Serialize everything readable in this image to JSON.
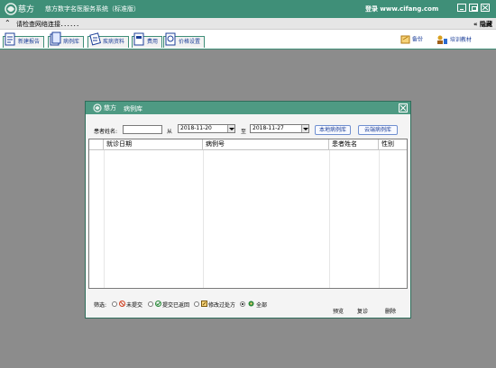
{
  "app": {
    "title": "慈方数字名医服务系统（标准版）",
    "login_text": "登录 www.cifang.com",
    "logo_label": "慈方"
  },
  "notice": {
    "text": "请检查网络连接．．．．．．",
    "right_label": "隐藏"
  },
  "toolbar": {
    "tabs": [
      {
        "label": "新建报告",
        "icon": "new-report-icon"
      },
      {
        "label": "病例库",
        "icon": "case-library-icon"
      },
      {
        "label": "疾病资料",
        "icon": "disease-data-icon"
      },
      {
        "label": "费用",
        "icon": "fee-icon"
      },
      {
        "label": "价格设置",
        "icon": "price-settings-icon"
      }
    ],
    "backup_label": "备份",
    "training_label": "培训教材"
  },
  "dialog": {
    "title": "病例库",
    "logo_label": "慈方",
    "patient_name_label": "患者姓名:",
    "patient_name_value": "",
    "from_label": "从",
    "from_date": "2018-11-20",
    "to_label": "至",
    "to_date": "2018-11-27",
    "local_button": "本地病例库",
    "cloud_button": "云端病例库",
    "columns": [
      "就诊日期",
      "病例号",
      "患者姓名",
      "性别"
    ],
    "rows": [],
    "filter_label": "筛选:",
    "filters": [
      {
        "label": "未提交",
        "selected": false
      },
      {
        "label": "提交已返回",
        "selected": false
      },
      {
        "label": "修改过处方",
        "selected": false
      },
      {
        "label": "全部",
        "selected": true
      }
    ],
    "preview_button": "预览",
    "revisit_button": "复诊",
    "delete_button": "删除"
  },
  "colors": {
    "title_bar": "#3f8f78",
    "dialog_title": "#4e9a83",
    "background": "#8c8c8c",
    "link_blue": "#1c3f99"
  }
}
